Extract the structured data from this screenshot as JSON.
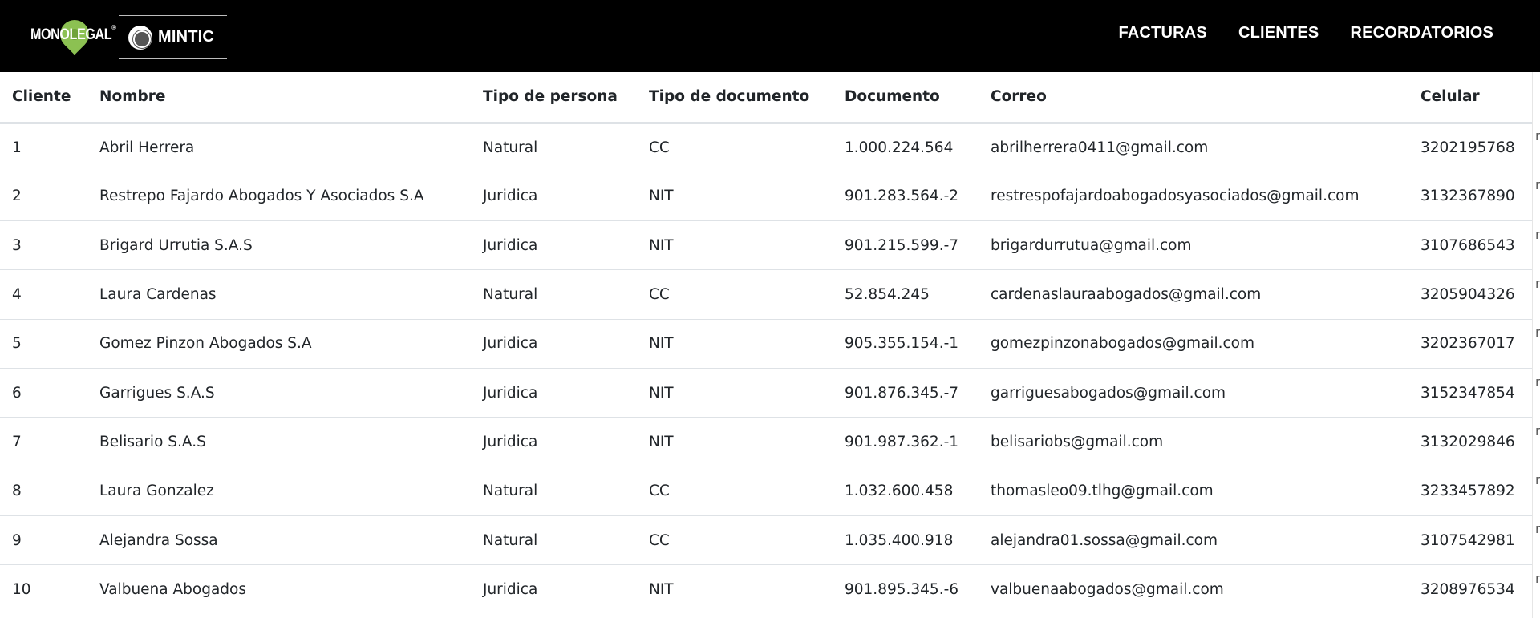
{
  "nav": {
    "brand_primary": "MONOLEGAL",
    "brand_secondary": "MINTIC",
    "links": [
      {
        "label": "FACTURAS"
      },
      {
        "label": "CLIENTES"
      },
      {
        "label": "RECORDATORIOS"
      }
    ]
  },
  "table": {
    "headers": [
      "Cliente",
      "Nombre",
      "Tipo de persona",
      "Tipo de documento",
      "Documento",
      "Correo",
      "Celular"
    ],
    "rows": [
      [
        "1",
        "Abril Herrera",
        "Natural",
        "CC",
        "1.000.224.564",
        "abrilherrera0411@gmail.com",
        "3202195768"
      ],
      [
        "2",
        "Restrepo Fajardo Abogados Y Asociados S.A",
        "Juridica",
        "NIT",
        "901.283.564.-2",
        "restrespofajardoabogadosyasociados@gmail.com",
        "3132367890"
      ],
      [
        "3",
        "Brigard Urrutia S.A.S",
        "Juridica",
        "NIT",
        "901.215.599.-7",
        "brigardurrutua@gmail.com",
        "3107686543"
      ],
      [
        "4",
        "Laura Cardenas",
        "Natural",
        "CC",
        "52.854.245",
        "cardenaslauraabogados@gmail.com",
        "3205904326"
      ],
      [
        "5",
        "Gomez Pinzon Abogados S.A",
        "Juridica",
        "NIT",
        "905.355.154.-1",
        "gomezpinzonabogados@gmail.com",
        "3202367017"
      ],
      [
        "6",
        "Garrigues S.A.S",
        "Juridica",
        "NIT",
        "901.876.345.-7",
        "garriguesabogados@gmail.com",
        "3152347854"
      ],
      [
        "7",
        "Belisario S.A.S",
        "Juridica",
        "NIT",
        "901.987.362.-1",
        "belisariobs@gmail.com",
        "3132029846"
      ],
      [
        "8",
        "Laura Gonzalez",
        "Natural",
        "CC",
        "1.032.600.458",
        "thomasleo09.tlhg@gmail.com",
        "3233457892"
      ],
      [
        "9",
        "Alejandra Sossa",
        "Natural",
        "CC",
        "1.035.400.918",
        "alejandra01.sossa@gmail.com",
        "3107542981"
      ],
      [
        "10",
        "Valbuena Abogados",
        "Juridica",
        "NIT",
        "901.895.345.-6",
        "valbuenaabogados@gmail.com",
        "3208976534"
      ]
    ]
  },
  "edge_char": "r",
  "colors": {
    "navbar": "#000000",
    "accent_green": "#8cc152",
    "row_border": "#dee2e6"
  }
}
